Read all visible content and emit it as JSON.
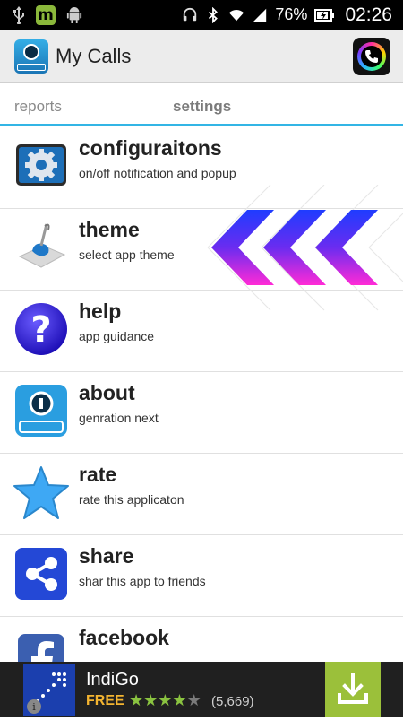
{
  "status_bar": {
    "battery": "76%",
    "time": "02:26",
    "icons": [
      "usb-icon",
      "m-notification-icon",
      "android-icon",
      "headset-icon",
      "bluetooth-icon",
      "wifi-icon",
      "signal-icon",
      "battery-icon"
    ]
  },
  "action_bar": {
    "title": "My Calls",
    "logo_icon": "my-calls-app-icon",
    "action_icon": "call-icon"
  },
  "tabs": {
    "items": [
      {
        "label": "reports",
        "selected": false
      },
      {
        "label": "settings",
        "selected": true
      }
    ],
    "accent_color": "#33b5e5"
  },
  "settings_list": {
    "items": [
      {
        "icon": "gear-icon",
        "title": "configuraitons",
        "subtitle": "on/off notification and popup"
      },
      {
        "icon": "theme-paint-icon",
        "title": "theme",
        "subtitle": "select app theme"
      },
      {
        "icon": "help-question-icon",
        "title": "help",
        "subtitle": "app guidance"
      },
      {
        "icon": "my-calls-app-icon",
        "title": "about",
        "subtitle": "genration next"
      },
      {
        "icon": "star-icon",
        "title": "rate",
        "subtitle": "rate this applicaton"
      },
      {
        "icon": "share-icon",
        "title": "share",
        "subtitle": "shar this app to friends"
      },
      {
        "icon": "facebook-icon",
        "title": "facebook",
        "subtitle": ""
      }
    ]
  },
  "ad_banner": {
    "app_name": "IndiGo",
    "price": "FREE",
    "rating": 4,
    "rating_max": 5,
    "review_count": "(5,669)",
    "info_glyph": "i",
    "icon": "download-icon"
  }
}
